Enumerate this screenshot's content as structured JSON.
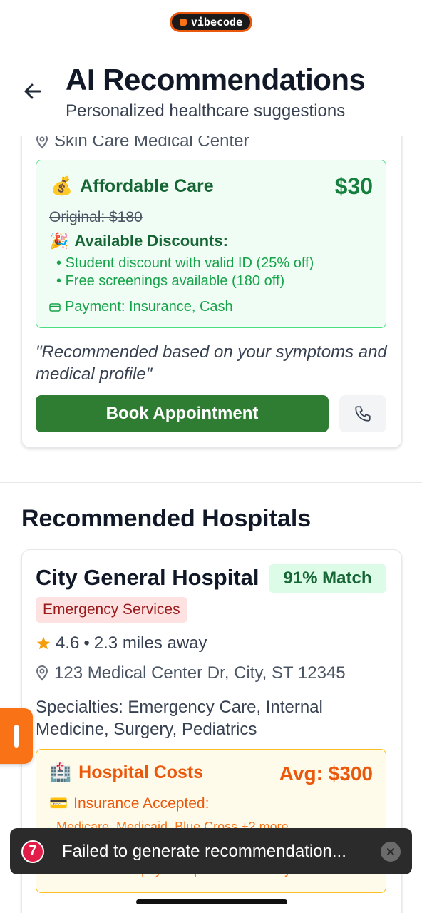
{
  "top_badge": {
    "label": "vibecode"
  },
  "header": {
    "title": "AI Recommendations",
    "subtitle": "Personalized healthcare suggestions"
  },
  "clinic_card": {
    "location": "Skin Care Medical Center",
    "affordable": {
      "emoji": "💰",
      "title": "Affordable Care",
      "price": "$30",
      "original": "Original: $180",
      "discounts_emoji": "🎉",
      "discounts_title": "Available Discounts:",
      "discounts": [
        "Student discount with valid ID (25% off)",
        "Free screenings available (180 off)"
      ],
      "payment": "Payment: Insurance, Cash"
    },
    "quote": "\"Recommended based on your symptoms and medical profile\"",
    "book_label": "Book Appointment"
  },
  "section_title": "Recommended Hospitals",
  "hospital": {
    "name": "City General Hospital",
    "match": "91% Match",
    "badge": "Emergency Services",
    "rating": "4.6",
    "distance": "2.3 miles away",
    "address": "123 Medical Center Dr, City, ST 12345",
    "specialties": "Specialties: Emergency Care, Internal Medicine, Surgery, Pediatrics",
    "costs": {
      "emoji": "🏥",
      "title": "Hospital Costs",
      "avg": "Avg: $300",
      "insurance_emoji": "💳",
      "insurance_title": "Insurance Accepted:",
      "insurance_list": "Medicare, Medicaid, Blue Cross +2 more",
      "plans": "Income-based payment plans and charity care"
    }
  },
  "toast": {
    "count": "7",
    "message": "Failed to generate recommendation..."
  },
  "colors": {
    "primary": "#2e7d32",
    "accent": "#f97316",
    "error": "#e11d48"
  }
}
